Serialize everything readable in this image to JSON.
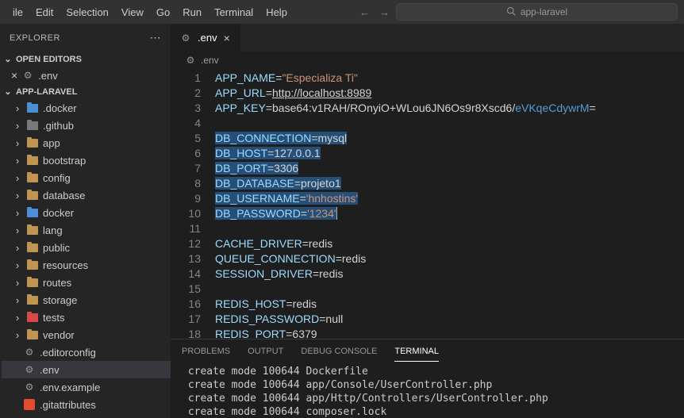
{
  "menubar": {
    "items": [
      "ile",
      "Edit",
      "Selection",
      "View",
      "Go",
      "Run",
      "Terminal",
      "Help"
    ],
    "search": "app-laravel"
  },
  "explorer": {
    "title": "EXPLORER",
    "sections": {
      "openEditors": {
        "label": "OPEN EDITORS",
        "items": [
          {
            "label": ".env"
          }
        ]
      },
      "workspace": {
        "label": "APP-LARAVEL"
      }
    },
    "tree": [
      {
        "label": ".docker",
        "icon": "blue"
      },
      {
        "label": ".github",
        "icon": "grey"
      },
      {
        "label": "app",
        "icon": "folder"
      },
      {
        "label": "bootstrap",
        "icon": "folder"
      },
      {
        "label": "config",
        "icon": "folder"
      },
      {
        "label": "database",
        "icon": "folder"
      },
      {
        "label": "docker",
        "icon": "blue"
      },
      {
        "label": "lang",
        "icon": "folder"
      },
      {
        "label": "public",
        "icon": "folder"
      },
      {
        "label": "resources",
        "icon": "folder"
      },
      {
        "label": "routes",
        "icon": "folder"
      },
      {
        "label": "storage",
        "icon": "folder"
      },
      {
        "label": "tests",
        "icon": "red"
      },
      {
        "label": "vendor",
        "icon": "folder"
      }
    ],
    "files": [
      {
        "label": ".editorconfig",
        "icon": "gear"
      },
      {
        "label": ".env",
        "icon": "gear",
        "active": true
      },
      {
        "label": ".env.example",
        "icon": "gear"
      },
      {
        "label": ".gitattributes",
        "icon": "git"
      }
    ]
  },
  "tab": {
    "label": ".env"
  },
  "breadcrumb": {
    "label": ".env"
  },
  "code": {
    "lines": [
      {
        "n": 1,
        "seg": [
          [
            "key",
            "APP_NAME"
          ],
          [
            "op",
            "="
          ],
          [
            "str",
            "\"Especializa Ti\""
          ]
        ]
      },
      {
        "n": 2,
        "seg": [
          [
            "key",
            "APP_URL"
          ],
          [
            "op",
            "="
          ],
          [
            "url",
            "http://localhost:8989"
          ]
        ]
      },
      {
        "n": 3,
        "seg": [
          [
            "key",
            "APP_KEY"
          ],
          [
            "op",
            "="
          ],
          [
            "plain",
            "base64:v1RAH/ROnyiO+WLou6JN6Os9r8Xscd6/"
          ],
          [
            "b64",
            "eVKqeCdywrM"
          ],
          [
            "op",
            "="
          ]
        ]
      },
      {
        "n": 4,
        "seg": []
      },
      {
        "n": 5,
        "sel": true,
        "seg": [
          [
            "key",
            "DB_CONNECTION"
          ],
          [
            "op",
            "="
          ],
          [
            "plain",
            "mysql"
          ]
        ]
      },
      {
        "n": 6,
        "sel": true,
        "seg": [
          [
            "key",
            "DB_HOST"
          ],
          [
            "op",
            "="
          ],
          [
            "plain",
            "127.0.0.1"
          ]
        ]
      },
      {
        "n": 7,
        "sel": true,
        "seg": [
          [
            "key",
            "DB_PORT"
          ],
          [
            "op",
            "="
          ],
          [
            "plain",
            "3306"
          ]
        ]
      },
      {
        "n": 8,
        "sel": true,
        "seg": [
          [
            "key",
            "DB_DATABASE"
          ],
          [
            "op",
            "="
          ],
          [
            "plain",
            "projeto1"
          ]
        ]
      },
      {
        "n": 9,
        "sel": true,
        "seg": [
          [
            "key",
            "DB_USERNAME"
          ],
          [
            "op",
            "="
          ],
          [
            "str",
            "'hnhostins'"
          ]
        ]
      },
      {
        "n": 10,
        "sel": true,
        "cursor": true,
        "seg": [
          [
            "key",
            "DB_PASSWORD"
          ],
          [
            "op",
            "="
          ],
          [
            "str",
            "'1234'"
          ]
        ]
      },
      {
        "n": 11,
        "seg": []
      },
      {
        "n": 12,
        "seg": [
          [
            "key",
            "CACHE_DRIVER"
          ],
          [
            "op",
            "="
          ],
          [
            "plain",
            "redis"
          ]
        ]
      },
      {
        "n": 13,
        "seg": [
          [
            "key",
            "QUEUE_CONNECTION"
          ],
          [
            "op",
            "="
          ],
          [
            "plain",
            "redis"
          ]
        ]
      },
      {
        "n": 14,
        "seg": [
          [
            "key",
            "SESSION_DRIVER"
          ],
          [
            "op",
            "="
          ],
          [
            "plain",
            "redis"
          ]
        ]
      },
      {
        "n": 15,
        "seg": []
      },
      {
        "n": 16,
        "seg": [
          [
            "key",
            "REDIS_HOST"
          ],
          [
            "op",
            "="
          ],
          [
            "plain",
            "redis"
          ]
        ]
      },
      {
        "n": 17,
        "seg": [
          [
            "key",
            "REDIS_PASSWORD"
          ],
          [
            "op",
            "="
          ],
          [
            "plain",
            "null"
          ]
        ]
      },
      {
        "n": 18,
        "seg": [
          [
            "key",
            "REDIS_PORT"
          ],
          [
            "op",
            "="
          ],
          [
            "plain",
            "6379"
          ]
        ]
      }
    ]
  },
  "panel": {
    "tabs": [
      "PROBLEMS",
      "OUTPUT",
      "DEBUG CONSOLE",
      "TERMINAL"
    ],
    "active": 3,
    "terminal": [
      " create mode 100644 Dockerfile",
      " create mode 100644 app/Console/UserController.php",
      " create mode 100644 app/Http/Controllers/UserController.php",
      " create mode 100644 composer.lock"
    ]
  }
}
